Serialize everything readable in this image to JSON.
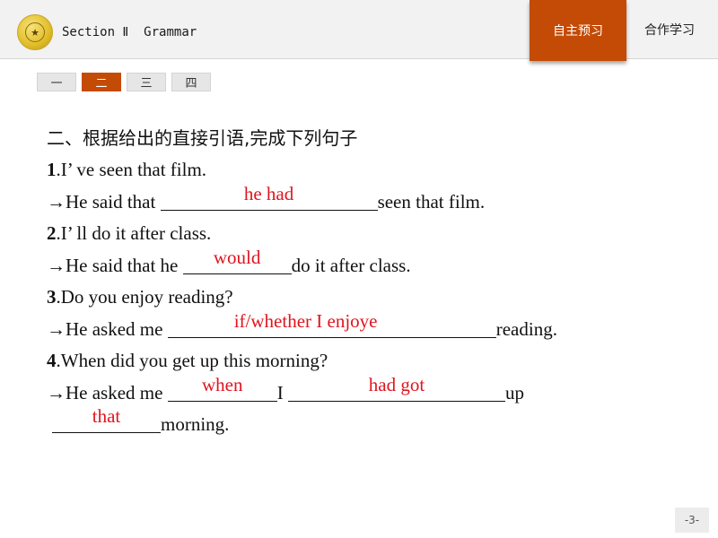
{
  "header": {
    "logo_icon": "school-emblem-icon",
    "logo_glyph": "★",
    "section_title": "Section Ⅱ  Grammar",
    "nav_tabs": [
      {
        "label": "自主预习",
        "active": true
      },
      {
        "label": "合作学习",
        "active": false
      }
    ]
  },
  "subtabs": [
    {
      "label": "一",
      "active": false
    },
    {
      "label": "二",
      "active": true
    },
    {
      "label": "三",
      "active": false
    },
    {
      "label": "四",
      "active": false
    }
  ],
  "exercise": {
    "heading": "二、根据给出的直接引语,完成下列句子",
    "items": [
      {
        "number": "1",
        "question": ".I’ ve seen that film.",
        "prefix": "→He said that ",
        "answer": "he had",
        "suffix": "seen that film."
      },
      {
        "number": "2",
        "question": ".I’ ll do it after class.",
        "prefix": "→He said that he ",
        "answer": "would",
        "suffix": "do it after class."
      },
      {
        "number": "3",
        "question": ".Do you enjoy reading?",
        "prefix": "→He asked me ",
        "answer": "if/whether I enjoye",
        "suffix": "reading."
      },
      {
        "number": "4",
        "question": ".When did you get up this morning?",
        "prefix": "→He asked me ",
        "answer1": "when",
        "mid": "I ",
        "answer2": "had got",
        "suffix1": "up",
        "answer3": "that",
        "suffix2": "morning."
      }
    ]
  },
  "colors": {
    "accent": "#c44b05",
    "answer": "#e0141e"
  },
  "page_number": "-3-"
}
